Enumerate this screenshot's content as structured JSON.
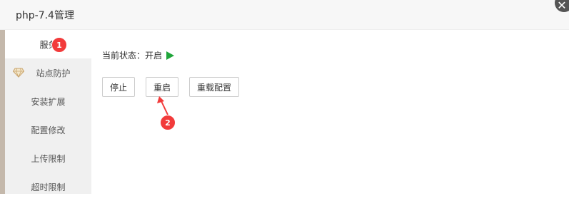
{
  "window": {
    "title": "php-7.4管理",
    "close_label": "✕"
  },
  "sidebar": {
    "items": [
      {
        "label": "服务",
        "active": true
      },
      {
        "label": "站点防护",
        "active": false
      },
      {
        "label": "安装扩展",
        "active": false
      },
      {
        "label": "配置修改",
        "active": false
      },
      {
        "label": "上传限制",
        "active": false
      },
      {
        "label": "超时限制",
        "active": false
      }
    ]
  },
  "service": {
    "status_label": "当前状态：",
    "status_value": "开启",
    "status_icon": "play-icon",
    "status_color": "#20a53a",
    "buttons": {
      "stop": "停止",
      "restart": "重启",
      "reload": "重载配置"
    }
  },
  "annotations": {
    "step1": "1",
    "step2": "2",
    "color": "#f23b3b"
  }
}
